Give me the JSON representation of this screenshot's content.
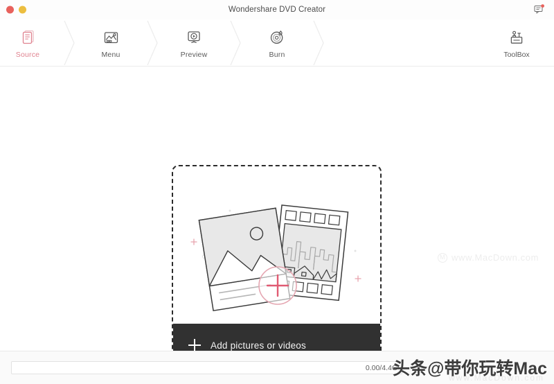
{
  "window": {
    "title": "Wondershare DVD Creator",
    "traffic_lights": [
      {
        "name": "close",
        "color": "#e8615c"
      },
      {
        "name": "minimize",
        "color": "#ecbe3f"
      }
    ],
    "feedback_icon": "chat-bubble-icon"
  },
  "toolbar": {
    "steps": [
      {
        "label": "Source",
        "icon": "document-stack-icon",
        "active": true
      },
      {
        "label": "Menu",
        "icon": "picture-icon",
        "active": false
      },
      {
        "label": "Preview",
        "icon": "monitor-play-icon",
        "active": false
      },
      {
        "label": "Burn",
        "icon": "disc-flame-icon",
        "active": false
      }
    ],
    "toolbox": {
      "label": "ToolBox",
      "icon": "toolbox-icon"
    },
    "active_color": "#e0828f",
    "inactive_color": "#5a5a5a"
  },
  "main": {
    "dropzone": {
      "illustration": "photo-and-filmstrip-illustration",
      "add_plus_icon": "plus-circle-icon",
      "add_label": "Add pictures or videos",
      "add_bar_color": "#313131",
      "border_style": "dashed"
    }
  },
  "watermarks": {
    "site": "www.MacDown.com",
    "site_logo": "M",
    "chinese": "头条@带你玩转Mac",
    "chinese_sub": "www.MacDown.com"
  },
  "statusbar": {
    "progress_text": "0.00/4.4G",
    "progress_percent": 0
  }
}
